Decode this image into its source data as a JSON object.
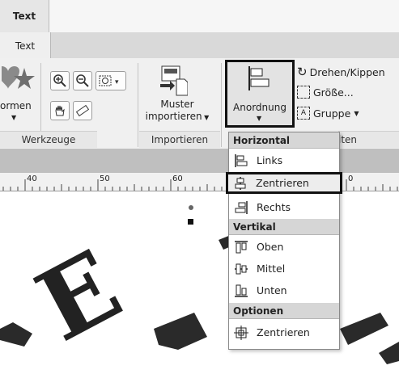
{
  "tabs": {
    "top_tab": "Text",
    "ribbon_tab": "Text"
  },
  "ribbon": {
    "formen_label": "ormen",
    "werkzeuge_label": "Werkzeuge",
    "muster_import_label_line1": "Muster",
    "muster_import_label_line2": "importieren",
    "importieren_group_label": "Importieren",
    "anordnung_label": "Anordnung",
    "drehen_label": "Drehen/Kippen",
    "groesse_label": "Größe...",
    "gruppe_label": "Gruppe",
    "partial_group_label": "iten"
  },
  "ruler": {
    "ticks": [
      "40",
      "50",
      "60",
      "0"
    ]
  },
  "menu": {
    "horizontal_header": "Horizontal",
    "links": "Links",
    "zentrieren_h": "Zentrieren",
    "rechts": "Rechts",
    "vertikal_header": "Vertikal",
    "oben": "Oben",
    "mittel": "Mittel",
    "unten": "Unten",
    "optionen_header": "Optionen",
    "zentrieren_opt": "Zentrieren"
  },
  "canvas": {
    "letter_E": "E"
  }
}
